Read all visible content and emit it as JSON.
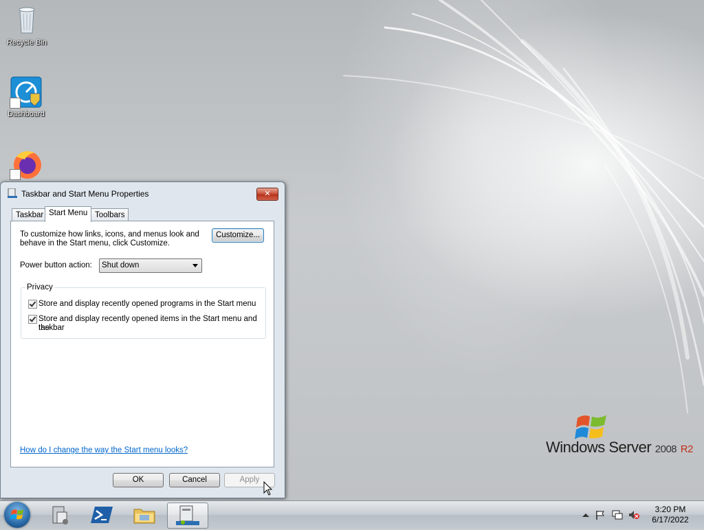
{
  "desktop": {
    "icons": [
      {
        "label": "Recycle Bin",
        "icon": "recycle-bin-icon"
      },
      {
        "label": "Dashboard",
        "icon": "dashboard-icon"
      },
      {
        "label": "",
        "icon": "firefox-icon"
      }
    ],
    "wallpaper_logo": {
      "brand": "Windows Server",
      "version": "2008",
      "edition": "R2"
    }
  },
  "dialog": {
    "title": "Taskbar and Start Menu Properties",
    "close_label": "✕",
    "tabs": [
      {
        "label": "Taskbar",
        "active": false
      },
      {
        "label": "Start Menu",
        "active": true
      },
      {
        "label": "Toolbars",
        "active": false
      }
    ],
    "start_menu": {
      "customize_text_line1": "To customize how links, icons, and menus look and",
      "customize_text_line2": "behave in the Start menu, click Customize.",
      "customize_button": "Customize...",
      "power_label": "Power button action:",
      "power_value": "Shut down",
      "privacy": {
        "legend": "Privacy",
        "options": [
          {
            "label": "Store and display recently opened programs in the Start menu",
            "checked": true
          },
          {
            "label_line1": "Store and display recently opened items in the Start menu and the",
            "label_line2": "taskbar",
            "checked": true
          }
        ]
      },
      "help_link": "How do I change the way the Start menu looks?"
    },
    "buttons": {
      "ok": "OK",
      "cancel": "Cancel",
      "apply": "Apply"
    }
  },
  "taskbar": {
    "start": "start-orb-icon",
    "pinned": [
      {
        "name": "server-manager-icon",
        "active": false
      },
      {
        "name": "powershell-icon",
        "active": false
      },
      {
        "name": "file-explorer-icon",
        "active": false
      },
      {
        "name": "taskbar-properties-icon",
        "active": true
      }
    ],
    "tray": {
      "icons": [
        "show-hidden-icons-icon",
        "action-center-flag-icon",
        "network-icon",
        "volume-muted-icon"
      ],
      "time": "3:20 PM",
      "date": "6/17/2022"
    }
  },
  "colors": {
    "link": "#0066cc",
    "close_button": "#c74c33",
    "edition_r2": "#c0301c"
  }
}
